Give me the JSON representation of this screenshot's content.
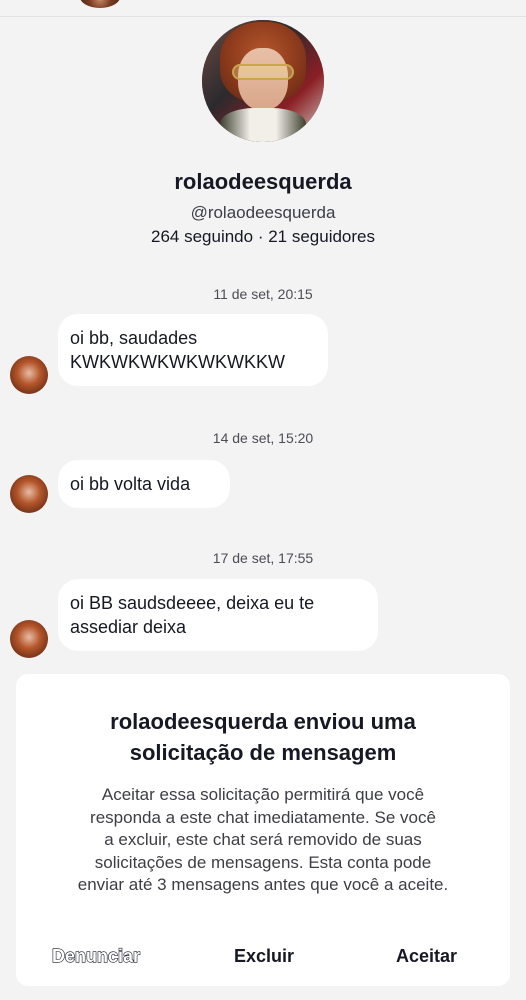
{
  "profile": {
    "username": "rolaodeesquerda",
    "handle": "@rolaodeesquerda",
    "stats": "264 seguindo · 21 seguidores"
  },
  "messages": [
    {
      "timestamp": "11 de set, 20:15",
      "lines": [
        "oi bb, saudades",
        "KWKWKWKWKWKWKKW"
      ]
    },
    {
      "timestamp": "14 de set, 15:20",
      "lines": [
        "oi bb volta vida"
      ]
    },
    {
      "timestamp": "17 de set, 17:55",
      "lines": [
        "oi BB saudsdeeee, deixa eu te",
        "assediar deixa"
      ]
    }
  ],
  "request_sheet": {
    "title_line1": "rolaodeesquerda enviou uma",
    "title_line2": "solicitação de mensagem",
    "body": [
      "Aceitar essa solicitação permitirá que você",
      "responda a este chat imediatamente. Se você",
      "a excluir, este chat será removido de suas",
      "solicitações de mensagens. Esta conta pode",
      "enviar até 3 mensagens antes que você a aceite."
    ],
    "actions": {
      "report": "Denunciar",
      "delete": "Excluir",
      "accept": "Aceitar"
    }
  }
}
